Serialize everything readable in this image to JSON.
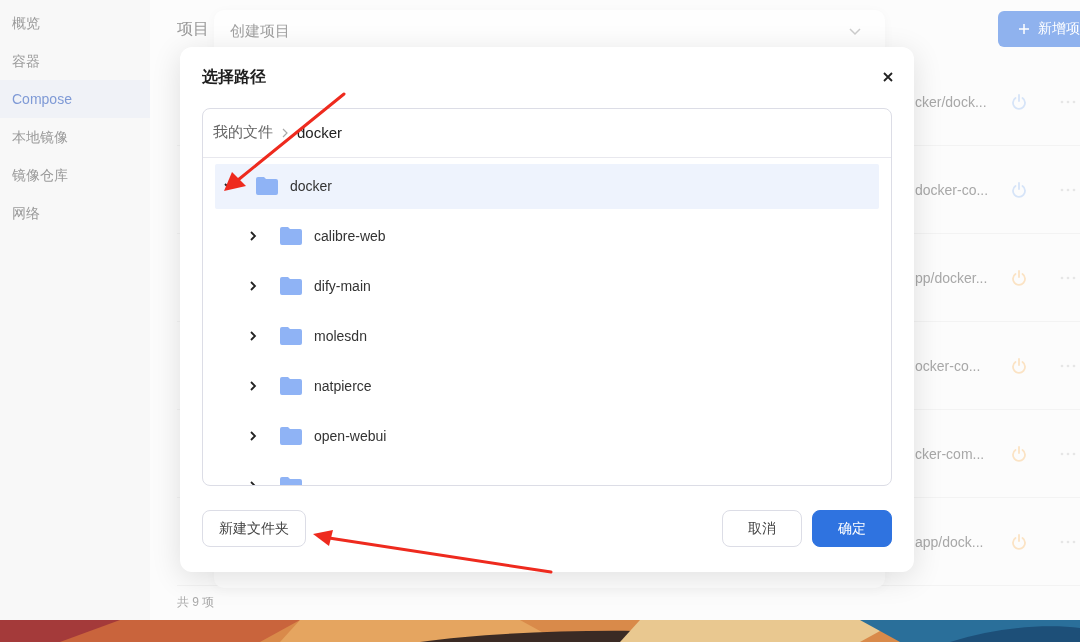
{
  "sidebar": {
    "items": [
      {
        "label": "概览",
        "selected": false
      },
      {
        "label": "容器",
        "selected": false
      },
      {
        "label": "Compose",
        "selected": true
      },
      {
        "label": "本地镜像",
        "selected": false
      },
      {
        "label": "镜像仓库",
        "selected": false
      },
      {
        "label": "网络",
        "selected": false
      }
    ]
  },
  "page": {
    "title": "项目",
    "add_button": "新增项",
    "rows": [
      {
        "path": "cker/dock...",
        "color": "#d6e4f8"
      },
      {
        "path": "docker-co...",
        "color": "#d6e4f8"
      },
      {
        "path": "pp/docker...",
        "color": "#fbe3c4"
      },
      {
        "path": "ocker-co...",
        "color": "#fbe3c4"
      },
      {
        "path": "cker-com...",
        "color": "#fbe3c4"
      },
      {
        "path": "app/dock...",
        "color": "#fbe3c4"
      }
    ],
    "footer": "共 9 项"
  },
  "behind_dialog": {
    "title": "创建项目"
  },
  "dialog": {
    "title": "选择路径",
    "breadcrumb": [
      "我的文件",
      "docker"
    ],
    "tree": [
      {
        "name": "docker",
        "expanded": true,
        "selected": true,
        "children": [
          {
            "name": "calibre-web",
            "expanded": false,
            "selected": false
          },
          {
            "name": "dify-main",
            "expanded": false,
            "selected": false
          },
          {
            "name": "molesdn",
            "expanded": false,
            "selected": false
          },
          {
            "name": "natpierce",
            "expanded": false,
            "selected": false
          },
          {
            "name": "open-webui",
            "expanded": false,
            "selected": false
          },
          {
            "expanded": false,
            "selected": false
          }
        ]
      }
    ],
    "buttons": {
      "new_folder": "新建文件夹",
      "cancel": "取消",
      "ok": "确定"
    }
  }
}
